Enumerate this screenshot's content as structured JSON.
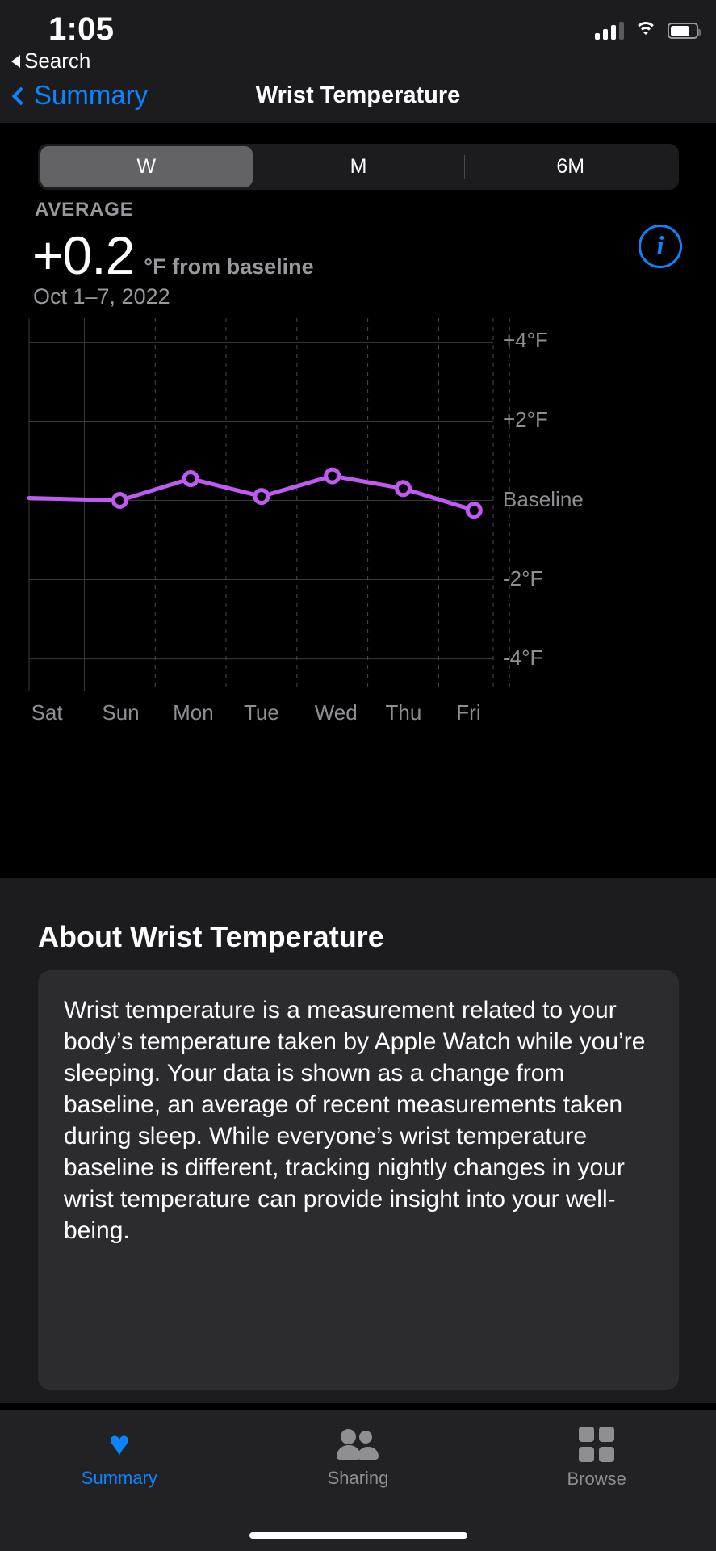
{
  "status_bar": {
    "time": "1:05",
    "back_to_app": "Search",
    "icons": {
      "signal": "cellular-signal-icon",
      "wifi": "wifi-icon",
      "battery": "battery-icon"
    }
  },
  "nav_bar": {
    "back_label": "Summary",
    "title": "Wrist Temperature"
  },
  "segmented_control": {
    "options": [
      "W",
      "M",
      "6M"
    ],
    "selected": "W"
  },
  "stats": {
    "label": "AVERAGE",
    "value": "+0.2",
    "unit": "°F from baseline",
    "date_range": "Oct 1–7, 2022",
    "info_button": "i"
  },
  "chart_data": {
    "type": "line",
    "title": "Wrist Temperature",
    "xlabel": "",
    "ylabel": "°F from baseline",
    "categories": [
      "Sat",
      "Sun",
      "Mon",
      "Tue",
      "Wed",
      "Thu",
      "Fri"
    ],
    "series": [
      {
        "name": "Wrist temperature change from baseline",
        "values": [
          null,
          0.0,
          0.55,
          0.1,
          0.62,
          0.3,
          -0.25
        ],
        "color": "#bf5af2"
      }
    ],
    "y_ticks": [
      "+4°F",
      "+2°F",
      "Baseline",
      "-2°F",
      "-4°F"
    ],
    "y_tick_values": [
      4,
      2,
      0,
      -2,
      -4
    ],
    "ylim": [
      -4.6,
      4.6
    ],
    "grid": true,
    "legend": "none",
    "marker": "open-circle",
    "baseline_value": 0
  },
  "about": {
    "title": "About Wrist Temperature",
    "body": "Wrist temperature is a measurement related to your body’s temperature taken by Apple Watch while you’re sleeping. Your data is shown as a change from baseline, an average of recent measurements taken during sleep. While everyone’s wrist temperature baseline is different, tracking nightly changes in your wrist temperature can provide insight into your well-being."
  },
  "tab_bar": {
    "items": [
      {
        "label": "Summary",
        "icon": "heart-icon",
        "active": true
      },
      {
        "label": "Sharing",
        "icon": "people-icon",
        "active": false
      },
      {
        "label": "Browse",
        "icon": "grid-icon",
        "active": false
      }
    ]
  }
}
